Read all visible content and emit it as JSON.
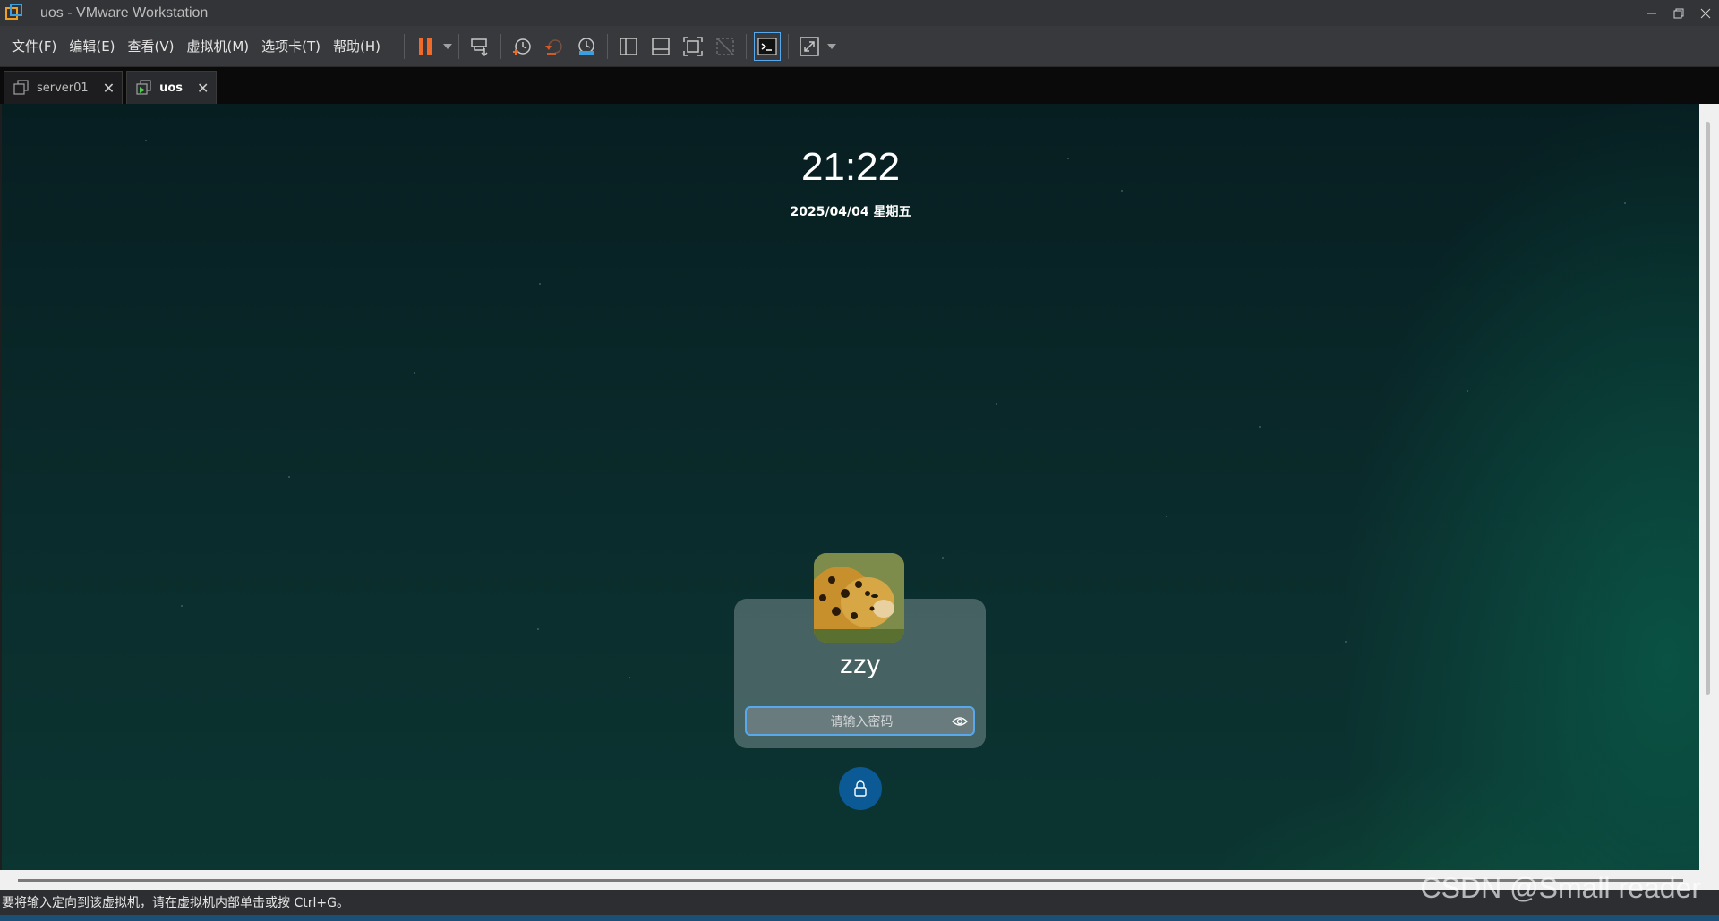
{
  "window": {
    "title": "uos - VMware Workstation"
  },
  "menu": [
    "文件(F)",
    "编辑(E)",
    "查看(V)",
    "虚拟机(M)",
    "选项卡(T)",
    "帮助(H)"
  ],
  "tabs": [
    {
      "label": "server01",
      "active": false
    },
    {
      "label": "uos",
      "active": true
    }
  ],
  "lockscreen": {
    "time": "21:22",
    "date": "2025/04/04 星期五",
    "username": "zzy",
    "password_placeholder": "请输入密码"
  },
  "status": {
    "message": "要将输入定向到该虚拟机，请在虚拟机内部单击或按 Ctrl+G。"
  },
  "watermark": "CSDN @Small reader",
  "colors": {
    "accent": "#58a8ee",
    "pause": "#f06a2a",
    "lock_button": "#0b5a96"
  }
}
